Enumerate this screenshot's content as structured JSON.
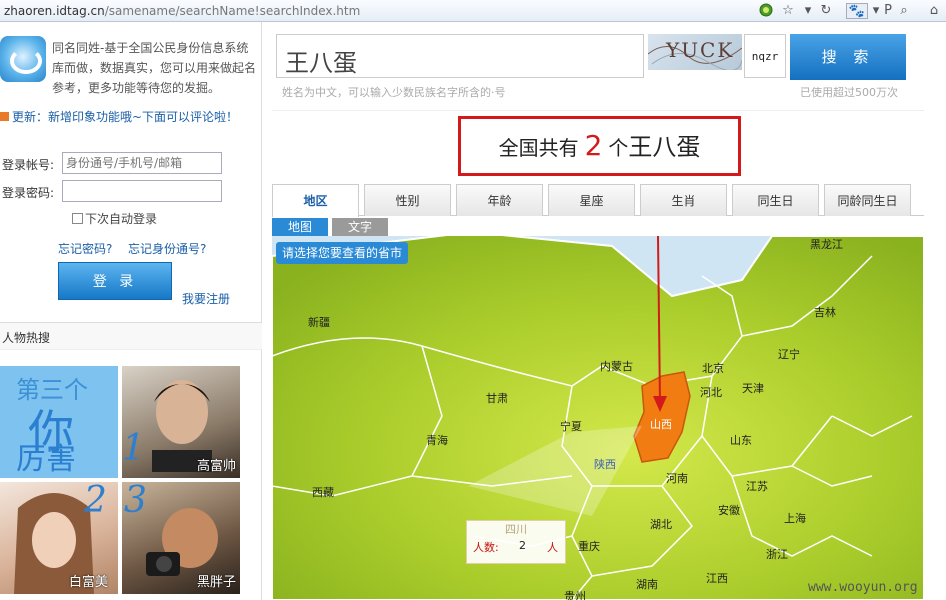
{
  "browser": {
    "url_domain": "zhaoren.idtag.cn",
    "url_path": "/samename/searchName!searchIndex.htm"
  },
  "left": {
    "intro": "同名同姓-基于全国公民身份信息系统库而做，数据真实，您可以用来做起名参考，更多功能等待您的发掘。",
    "update": "更新：新增印象功能哦~下面可以评论啦！",
    "account_label": "登录帐号:",
    "account_placeholder": "身份通号/手机号/邮箱",
    "password_label": "登录密码:",
    "auto_login": "下次自动登录",
    "forgot_password": "忘记密码?",
    "forgot_id": "忘记身份通号?",
    "login_button": "登 录",
    "register": "我要注册",
    "hot_title": "人物热搜",
    "hot_items": [
      {
        "text1": "第三个",
        "text2": "你",
        "text3": "厉害"
      },
      {
        "caption": "高富帅",
        "number": "1"
      },
      {
        "caption": "白富美",
        "number": "2"
      },
      {
        "caption": "黑胖子",
        "number": "3"
      }
    ]
  },
  "search": {
    "value": "王八蛋",
    "captcha_text": "YUCK",
    "captcha_input": "nqzr",
    "button": "搜 索",
    "hint": "姓名为中文，可以输入少数民族名字所含的·号",
    "used": "已使用超过500万次"
  },
  "result": {
    "prefix": "全国共有",
    "count": "2",
    "middle": "个",
    "name": "王八蛋"
  },
  "tabs": [
    "地区",
    "性别",
    "年龄",
    "星座",
    "生肖",
    "同生日",
    "同龄同生日"
  ],
  "subtabs": [
    "地图",
    "文字"
  ],
  "map": {
    "select_prompt": "请选择您要查看的省市",
    "provinces": [
      "黑龙江",
      "吉林",
      "新疆",
      "内蒙古",
      "北京",
      "辽宁",
      "天津",
      "甘肃",
      "宁夏",
      "河北",
      "山西",
      "青海",
      "陕西",
      "山东",
      "西藏",
      "河南",
      "江苏",
      "安徽",
      "上海",
      "湖北",
      "四川",
      "重庆",
      "浙江",
      "湖南",
      "江西",
      "贵州"
    ],
    "popup": {
      "title": "四川",
      "label": "人数:",
      "value": "2",
      "unit": "人"
    },
    "highlight_color": "#f07c12"
  },
  "watermark": "www.wooyun.org"
}
